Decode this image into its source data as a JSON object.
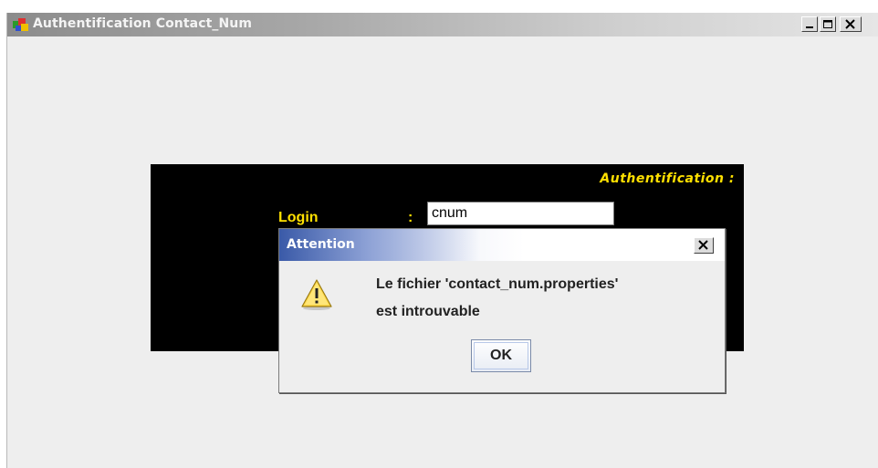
{
  "window": {
    "title": "Authentification Contact_Num",
    "controls": [
      "minimize-icon",
      "maximize-icon",
      "close-icon"
    ]
  },
  "auth_panel": {
    "heading": "Authentification :",
    "login_label": "Login",
    "separator": ":",
    "login_value": "cnum"
  },
  "dialog": {
    "title": "Attention",
    "icon": "warning-icon",
    "message_line1": "Le fichier 'contact_num.properties'",
    "message_line2": "est introuvable",
    "ok_label": "OK"
  },
  "colors": {
    "panel_bg": "#000000",
    "label_yellow": "#ffe000",
    "dialog_title_blue": "#3a5aa8"
  }
}
